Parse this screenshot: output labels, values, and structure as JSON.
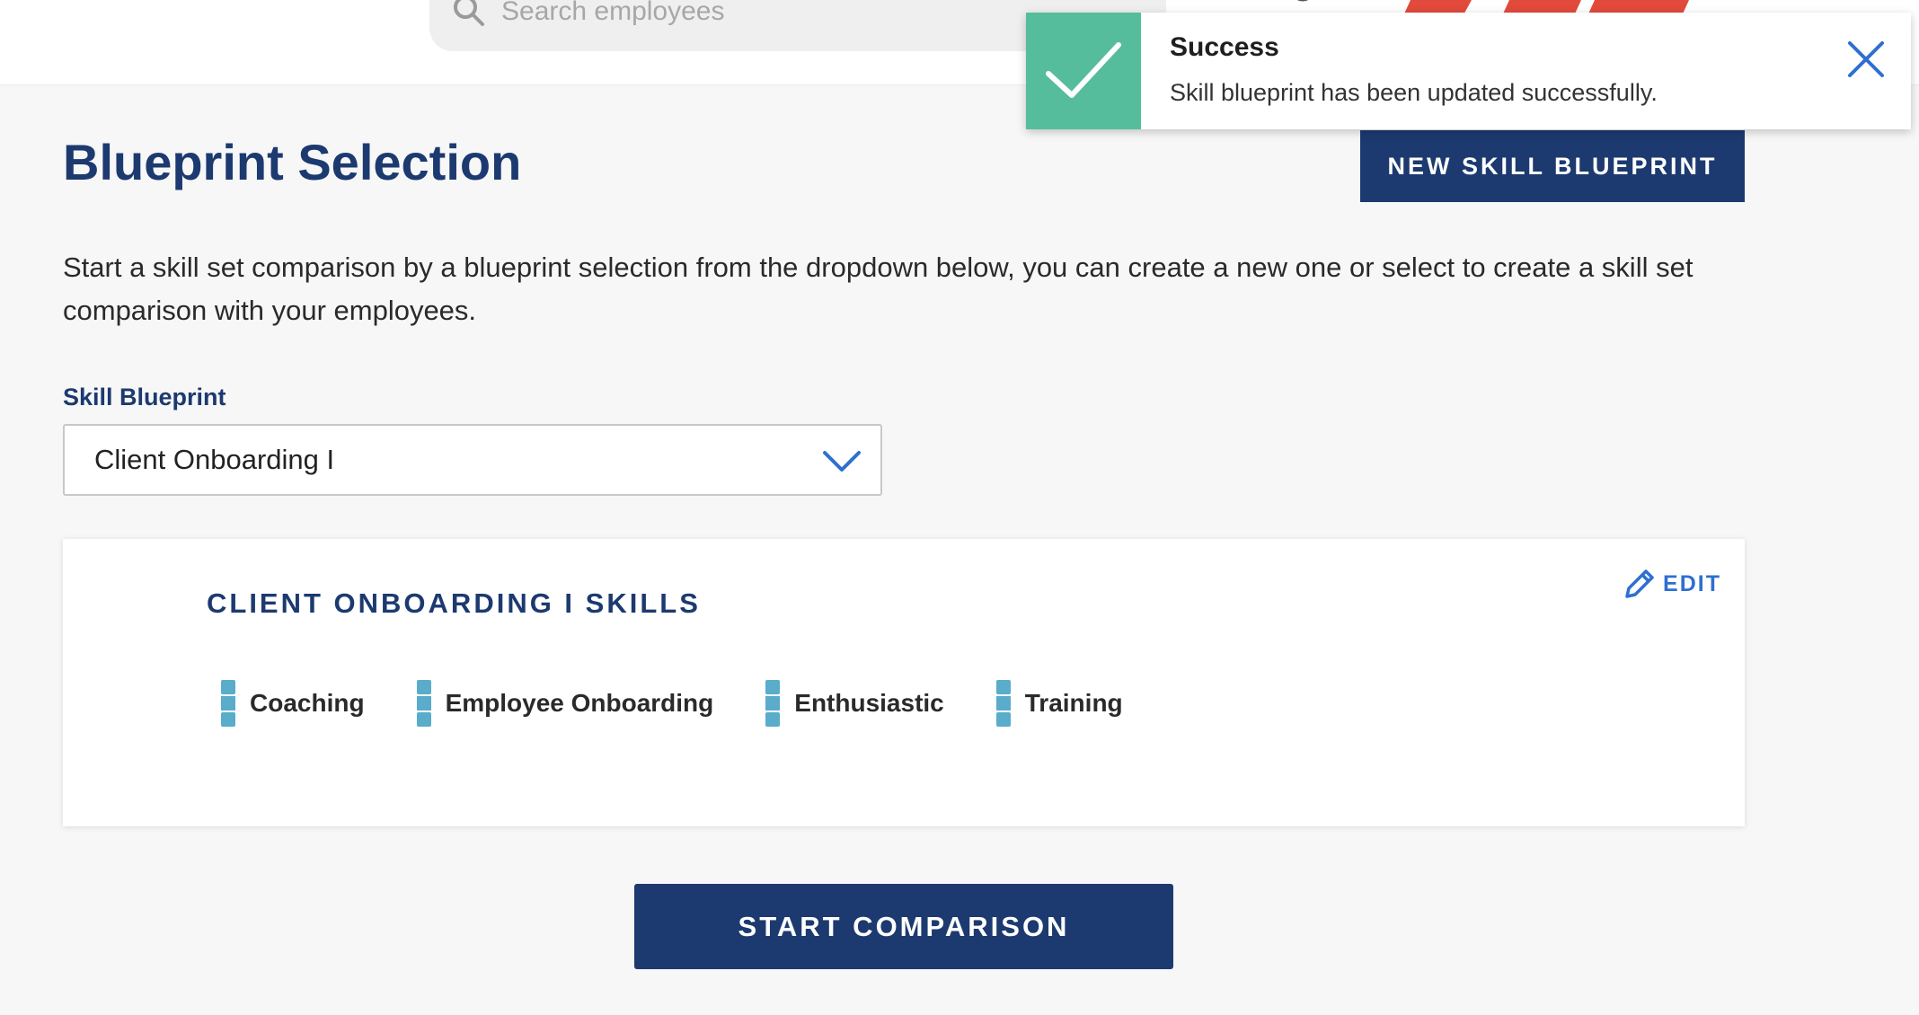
{
  "header": {
    "search": {
      "placeholder": "Search employees"
    },
    "colors": {
      "brand": "#e24a3b"
    }
  },
  "toast": {
    "title": "Success",
    "message": "Skill blueprint has been updated successfully.",
    "color": "#56bd9c"
  },
  "page": {
    "title": "Blueprint Selection",
    "new_button_label": "NEW SKILL BLUEPRINT",
    "description": "Start a skill set comparison by a blueprint selection from the dropdown below, you can create a new one or select to create a skill set comparison with your employees."
  },
  "blueprint_field": {
    "label": "Skill Blueprint",
    "selected": "Client Onboarding I"
  },
  "card": {
    "title": "CLIENT ONBOARDING I SKILLS",
    "edit_label": "EDIT",
    "skills": [
      {
        "name": "Coaching"
      },
      {
        "name": "Employee Onboarding"
      },
      {
        "name": "Enthusiastic"
      },
      {
        "name": "Training"
      }
    ]
  },
  "start_button_label": "START COMPARISON",
  "colors": {
    "primary": "#1c3a70",
    "link": "#2e6fd1",
    "skill_bar": "#5aaccb"
  }
}
